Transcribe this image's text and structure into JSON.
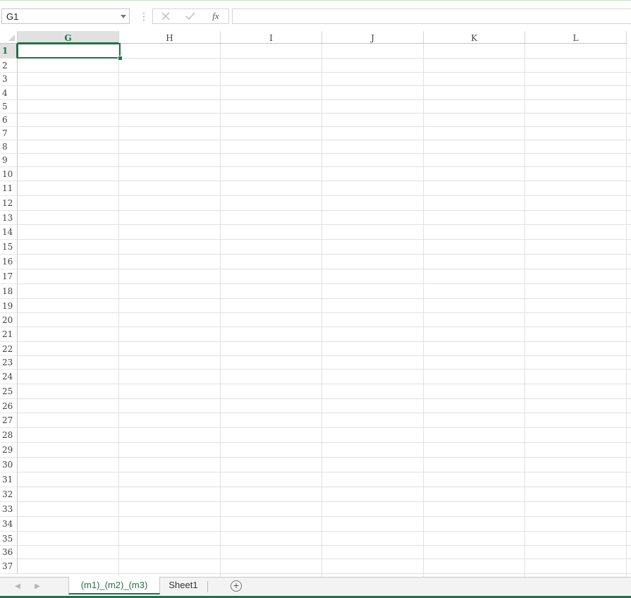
{
  "formula_bar": {
    "name_box_value": "G1",
    "separator": "⋮",
    "cancel_icon": "✕",
    "enter_icon": "✓",
    "fx_label": "fx",
    "formula_value": ""
  },
  "columns": [
    "G",
    "H",
    "I",
    "J",
    "K",
    "L"
  ],
  "active_column": "G",
  "rows": [
    "1",
    "2",
    "3",
    "4",
    "5",
    "6",
    "7",
    "8",
    "9",
    "10",
    "11",
    "12",
    "13",
    "14",
    "15",
    "16",
    "17",
    "18",
    "19",
    "20",
    "21",
    "22",
    "23",
    "24",
    "25",
    "26",
    "27",
    "28",
    "29",
    "30",
    "31",
    "32",
    "33",
    "34",
    "35",
    "36",
    "37"
  ],
  "active_row": "1",
  "active_cell": "G1",
  "sheet_tabs": {
    "prev_icon": "◀",
    "next_icon": "▶",
    "tabs": [
      {
        "label": "(m1)_(m2)_(m3)",
        "active": true
      },
      {
        "label": "Sheet1",
        "active": false
      }
    ],
    "add_icon": "+"
  },
  "colors": {
    "accent": "#217346",
    "gridline": "#e1e1e1",
    "header_border": "#c6c6c6"
  }
}
